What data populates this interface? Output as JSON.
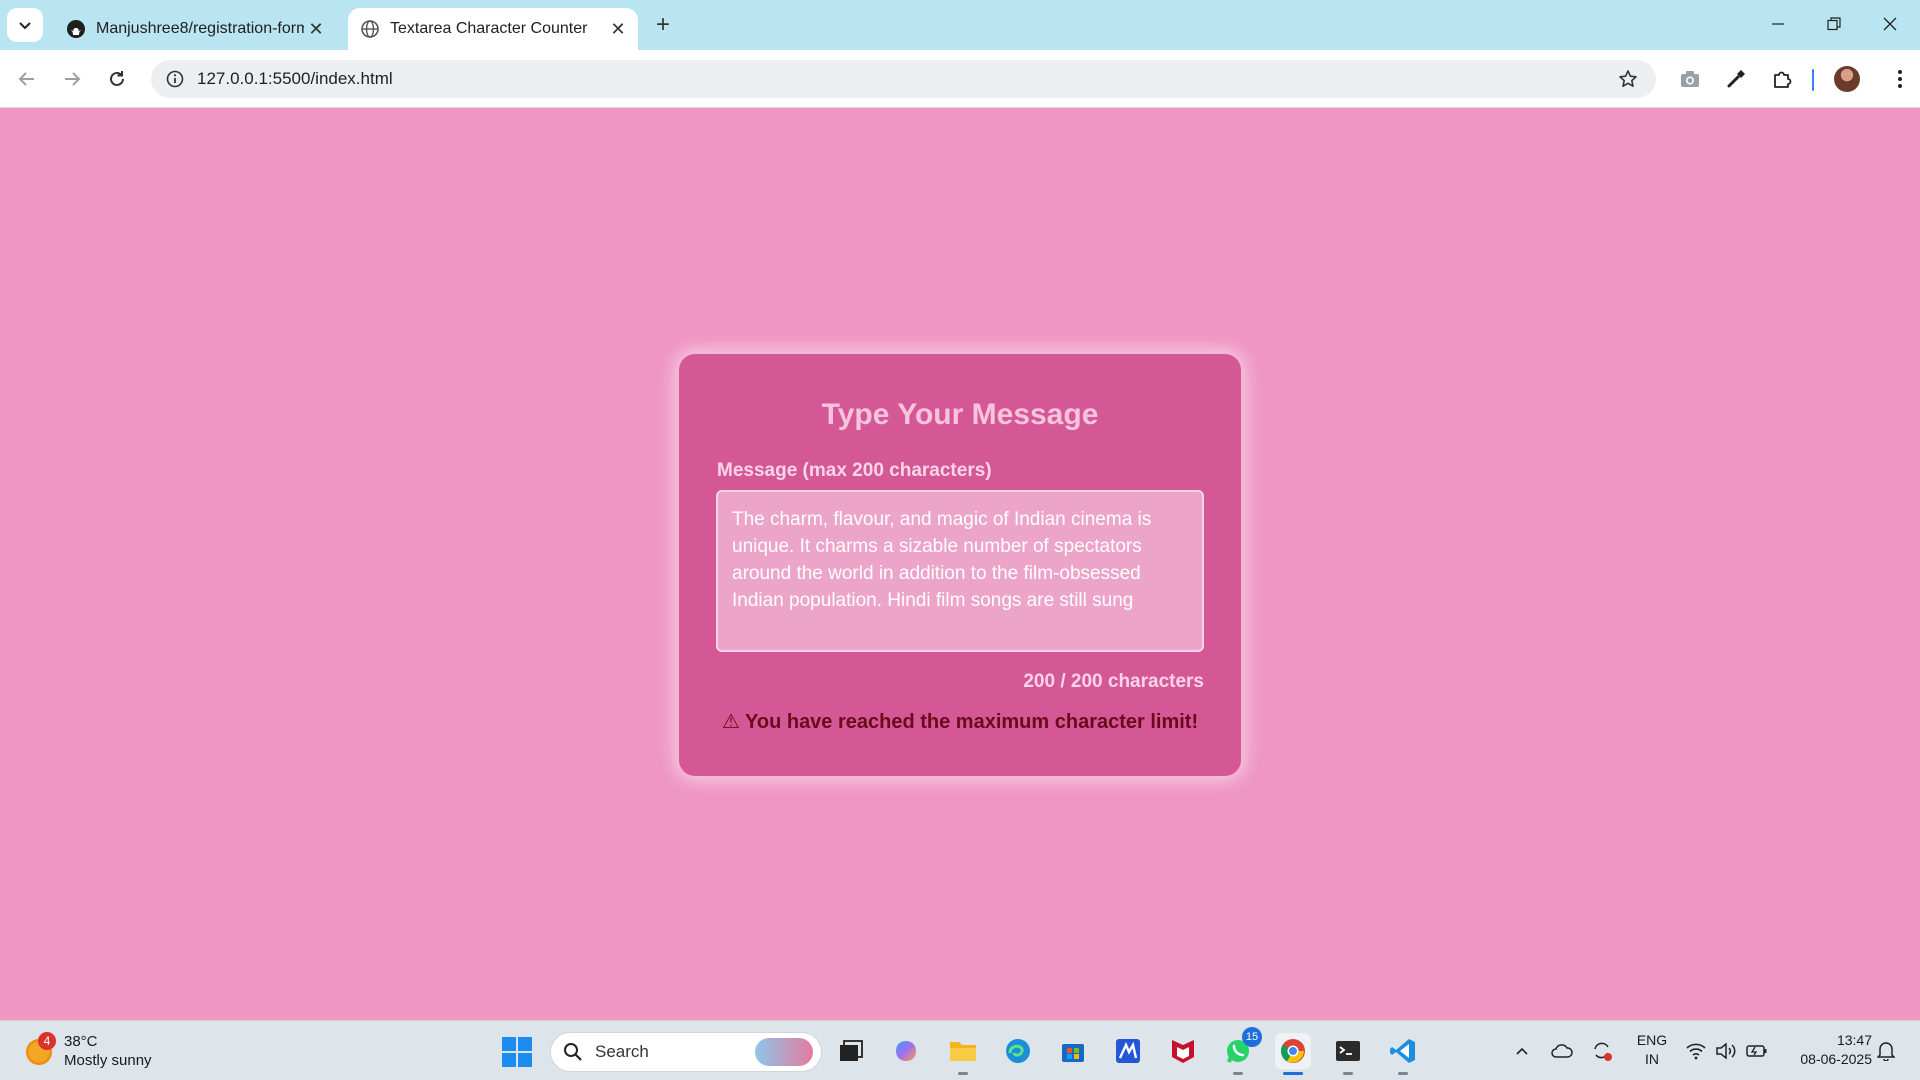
{
  "browser": {
    "tabs": [
      {
        "title": "Manjushree8/registration-form",
        "icon": "github-icon",
        "active": false
      },
      {
        "title": "Textarea Character Counter",
        "icon": "globe-icon",
        "active": true
      }
    ],
    "url": "127.0.0.1:5500/index.html"
  },
  "page": {
    "title": "Type Your Message",
    "label": "Message (max 200 characters)",
    "message": "The charm, flavour, and magic of Indian cinema is unique. It charms a sizable number of spectators around the world in addition to the film-obsessed Indian population. Hindi film songs are still sung ",
    "counter": "200 / 200 characters",
    "warning": "⚠ You have reached the maximum character limit!",
    "colors": {
      "background": "#ef96c3",
      "card": "#d45896",
      "warning": "#6b0a1c"
    }
  },
  "taskbar": {
    "weather": {
      "badge": "4",
      "temp": "38°C",
      "condition": "Mostly sunny"
    },
    "search_placeholder": "Search",
    "whatsapp_badge": "15",
    "lang": {
      "line1": "ENG",
      "line2": "IN"
    },
    "clock": {
      "time": "13:47",
      "date": "08-06-2025"
    }
  }
}
